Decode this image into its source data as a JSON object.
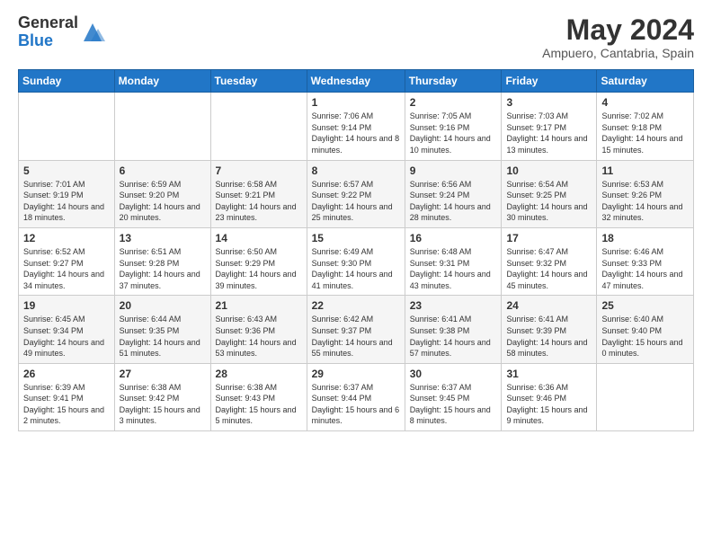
{
  "header": {
    "logo_general": "General",
    "logo_blue": "Blue",
    "month_title": "May 2024",
    "location": "Ampuero, Cantabria, Spain"
  },
  "weekdays": [
    "Sunday",
    "Monday",
    "Tuesday",
    "Wednesday",
    "Thursday",
    "Friday",
    "Saturday"
  ],
  "weeks": [
    [
      {
        "day": "",
        "info": ""
      },
      {
        "day": "",
        "info": ""
      },
      {
        "day": "",
        "info": ""
      },
      {
        "day": "1",
        "info": "Sunrise: 7:06 AM\nSunset: 9:14 PM\nDaylight: 14 hours\nand 8 minutes."
      },
      {
        "day": "2",
        "info": "Sunrise: 7:05 AM\nSunset: 9:16 PM\nDaylight: 14 hours\nand 10 minutes."
      },
      {
        "day": "3",
        "info": "Sunrise: 7:03 AM\nSunset: 9:17 PM\nDaylight: 14 hours\nand 13 minutes."
      },
      {
        "day": "4",
        "info": "Sunrise: 7:02 AM\nSunset: 9:18 PM\nDaylight: 14 hours\nand 15 minutes."
      }
    ],
    [
      {
        "day": "5",
        "info": "Sunrise: 7:01 AM\nSunset: 9:19 PM\nDaylight: 14 hours\nand 18 minutes."
      },
      {
        "day": "6",
        "info": "Sunrise: 6:59 AM\nSunset: 9:20 PM\nDaylight: 14 hours\nand 20 minutes."
      },
      {
        "day": "7",
        "info": "Sunrise: 6:58 AM\nSunset: 9:21 PM\nDaylight: 14 hours\nand 23 minutes."
      },
      {
        "day": "8",
        "info": "Sunrise: 6:57 AM\nSunset: 9:22 PM\nDaylight: 14 hours\nand 25 minutes."
      },
      {
        "day": "9",
        "info": "Sunrise: 6:56 AM\nSunset: 9:24 PM\nDaylight: 14 hours\nand 28 minutes."
      },
      {
        "day": "10",
        "info": "Sunrise: 6:54 AM\nSunset: 9:25 PM\nDaylight: 14 hours\nand 30 minutes."
      },
      {
        "day": "11",
        "info": "Sunrise: 6:53 AM\nSunset: 9:26 PM\nDaylight: 14 hours\nand 32 minutes."
      }
    ],
    [
      {
        "day": "12",
        "info": "Sunrise: 6:52 AM\nSunset: 9:27 PM\nDaylight: 14 hours\nand 34 minutes."
      },
      {
        "day": "13",
        "info": "Sunrise: 6:51 AM\nSunset: 9:28 PM\nDaylight: 14 hours\nand 37 minutes."
      },
      {
        "day": "14",
        "info": "Sunrise: 6:50 AM\nSunset: 9:29 PM\nDaylight: 14 hours\nand 39 minutes."
      },
      {
        "day": "15",
        "info": "Sunrise: 6:49 AM\nSunset: 9:30 PM\nDaylight: 14 hours\nand 41 minutes."
      },
      {
        "day": "16",
        "info": "Sunrise: 6:48 AM\nSunset: 9:31 PM\nDaylight: 14 hours\nand 43 minutes."
      },
      {
        "day": "17",
        "info": "Sunrise: 6:47 AM\nSunset: 9:32 PM\nDaylight: 14 hours\nand 45 minutes."
      },
      {
        "day": "18",
        "info": "Sunrise: 6:46 AM\nSunset: 9:33 PM\nDaylight: 14 hours\nand 47 minutes."
      }
    ],
    [
      {
        "day": "19",
        "info": "Sunrise: 6:45 AM\nSunset: 9:34 PM\nDaylight: 14 hours\nand 49 minutes."
      },
      {
        "day": "20",
        "info": "Sunrise: 6:44 AM\nSunset: 9:35 PM\nDaylight: 14 hours\nand 51 minutes."
      },
      {
        "day": "21",
        "info": "Sunrise: 6:43 AM\nSunset: 9:36 PM\nDaylight: 14 hours\nand 53 minutes."
      },
      {
        "day": "22",
        "info": "Sunrise: 6:42 AM\nSunset: 9:37 PM\nDaylight: 14 hours\nand 55 minutes."
      },
      {
        "day": "23",
        "info": "Sunrise: 6:41 AM\nSunset: 9:38 PM\nDaylight: 14 hours\nand 57 minutes."
      },
      {
        "day": "24",
        "info": "Sunrise: 6:41 AM\nSunset: 9:39 PM\nDaylight: 14 hours\nand 58 minutes."
      },
      {
        "day": "25",
        "info": "Sunrise: 6:40 AM\nSunset: 9:40 PM\nDaylight: 15 hours\nand 0 minutes."
      }
    ],
    [
      {
        "day": "26",
        "info": "Sunrise: 6:39 AM\nSunset: 9:41 PM\nDaylight: 15 hours\nand 2 minutes."
      },
      {
        "day": "27",
        "info": "Sunrise: 6:38 AM\nSunset: 9:42 PM\nDaylight: 15 hours\nand 3 minutes."
      },
      {
        "day": "28",
        "info": "Sunrise: 6:38 AM\nSunset: 9:43 PM\nDaylight: 15 hours\nand 5 minutes."
      },
      {
        "day": "29",
        "info": "Sunrise: 6:37 AM\nSunset: 9:44 PM\nDaylight: 15 hours\nand 6 minutes."
      },
      {
        "day": "30",
        "info": "Sunrise: 6:37 AM\nSunset: 9:45 PM\nDaylight: 15 hours\nand 8 minutes."
      },
      {
        "day": "31",
        "info": "Sunrise: 6:36 AM\nSunset: 9:46 PM\nDaylight: 15 hours\nand 9 minutes."
      },
      {
        "day": "",
        "info": ""
      }
    ]
  ]
}
